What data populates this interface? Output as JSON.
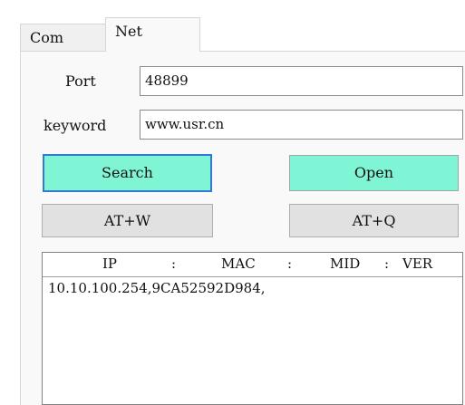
{
  "tabs": [
    {
      "label": "Com",
      "active": false
    },
    {
      "label": "Net",
      "active": true
    }
  ],
  "form": {
    "port_label": "Port",
    "port_value": "48899",
    "keyword_label": "keyword",
    "keyword_value": "www.usr.cn"
  },
  "buttons": {
    "search": "Search",
    "open": "Open",
    "at_w": "AT+W",
    "at_q": "AT+Q"
  },
  "list": {
    "headers": [
      "IP",
      ":",
      "MAC",
      ":",
      "MID",
      ":",
      "VER"
    ],
    "rows": [
      "10.10.100.254,9CA52592D984,"
    ]
  },
  "colors": {
    "accent_button": "#7ff5d5",
    "focus_border": "#2f7bd0",
    "gray_button": "#e1e1e1",
    "panel_bg": "#f9f9f9"
  }
}
